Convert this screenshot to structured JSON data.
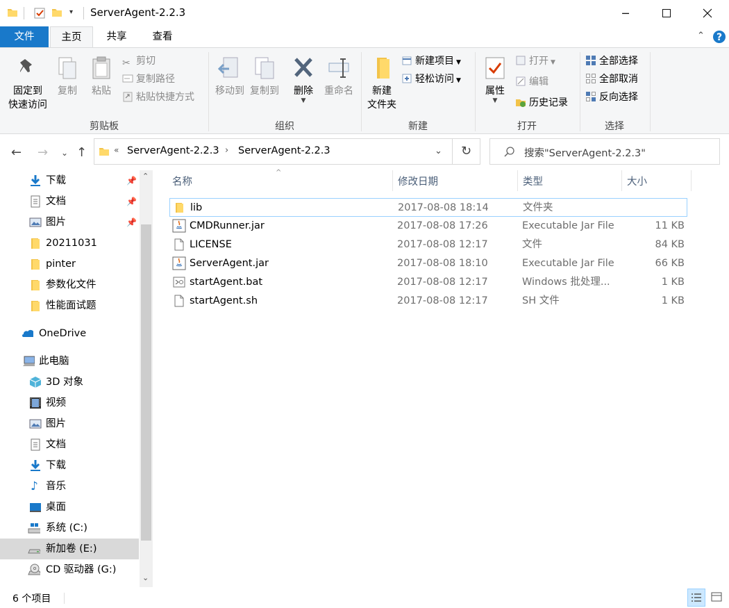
{
  "window": {
    "title": "ServerAgent-2.2.3"
  },
  "tabs": [
    "文件",
    "主页",
    "共享",
    "查看"
  ],
  "ribbon": {
    "clipboard": {
      "label": "剪贴板",
      "pin": [
        "固定到",
        "快速访问"
      ],
      "copy": "复制",
      "paste": "粘贴",
      "cut": "剪切",
      "copy_path": "复制路径",
      "paste_shortcut": "粘贴快捷方式"
    },
    "organize": {
      "label": "组织",
      "move_to": "移动到",
      "copy_to": "复制到",
      "delete": "删除",
      "rename": "重命名"
    },
    "new": {
      "label": "新建",
      "new_folder": [
        "新建",
        "文件夹"
      ],
      "new_item": "新建项目",
      "easy_access": "轻松访问"
    },
    "open": {
      "label": "打开",
      "properties": "属性",
      "open": "打开",
      "edit": "编辑",
      "history": "历史记录"
    },
    "select": {
      "label": "选择",
      "select_all": "全部选择",
      "select_none": "全部取消",
      "invert": "反向选择"
    }
  },
  "address": {
    "crumbs": [
      "ServerAgent-2.2.3",
      "ServerAgent-2.2.3"
    ],
    "search_placeholder": "搜索\"ServerAgent-2.2.3\""
  },
  "nav": [
    {
      "label": "下载",
      "icon": "download-icon",
      "pinned": true
    },
    {
      "label": "文档",
      "icon": "document-icon",
      "pinned": true
    },
    {
      "label": "图片",
      "icon": "picture-icon",
      "pinned": true
    },
    {
      "label": "20211031",
      "icon": "folder-icon"
    },
    {
      "label": "pinter",
      "icon": "folder-icon"
    },
    {
      "label": "参数化文件",
      "icon": "folder-icon"
    },
    {
      "label": "性能面试题",
      "icon": "folder-icon"
    },
    {
      "label": "OneDrive",
      "icon": "onedrive-icon"
    },
    {
      "label": "此电脑",
      "icon": "computer-icon"
    },
    {
      "label": "3D 对象",
      "icon": "3d-objects-icon"
    },
    {
      "label": "视频",
      "icon": "video-icon"
    },
    {
      "label": "图片",
      "icon": "picture-icon"
    },
    {
      "label": "文档",
      "icon": "document-icon"
    },
    {
      "label": "下载",
      "icon": "download-icon"
    },
    {
      "label": "音乐",
      "icon": "music-icon"
    },
    {
      "label": "桌面",
      "icon": "desktop-icon"
    },
    {
      "label": "系统 (C:)",
      "icon": "system-drive-icon"
    },
    {
      "label": "新加卷 (E:)",
      "icon": "drive-icon",
      "selected": true
    },
    {
      "label": "CD 驱动器 (G:)",
      "icon": "cd-drive-icon"
    }
  ],
  "columns": [
    "名称",
    "修改日期",
    "类型",
    "大小"
  ],
  "files": [
    {
      "name": "lib",
      "date": "2017-08-08 18:14",
      "type": "文件夹",
      "size": "",
      "icon": "folder-icon"
    },
    {
      "name": "CMDRunner.jar",
      "date": "2017-08-08 17:26",
      "type": "Executable Jar File",
      "size": "11 KB",
      "icon": "java-icon"
    },
    {
      "name": "LICENSE",
      "date": "2017-08-08 12:17",
      "type": "文件",
      "size": "84 KB",
      "icon": "file-icon"
    },
    {
      "name": "ServerAgent.jar",
      "date": "2017-08-08 18:10",
      "type": "Executable Jar File",
      "size": "66 KB",
      "icon": "java-icon"
    },
    {
      "name": "startAgent.bat",
      "date": "2017-08-08 12:17",
      "type": "Windows 批处理...",
      "size": "1 KB",
      "icon": "batch-file-icon"
    },
    {
      "name": "startAgent.sh",
      "date": "2017-08-08 12:17",
      "type": "SH 文件",
      "size": "1 KB",
      "icon": "file-icon"
    }
  ],
  "status": {
    "count": "6 个项目"
  },
  "colors": {
    "accent": "#1979ca",
    "folder": "#f2c34a",
    "selection": "#99d1ff"
  }
}
